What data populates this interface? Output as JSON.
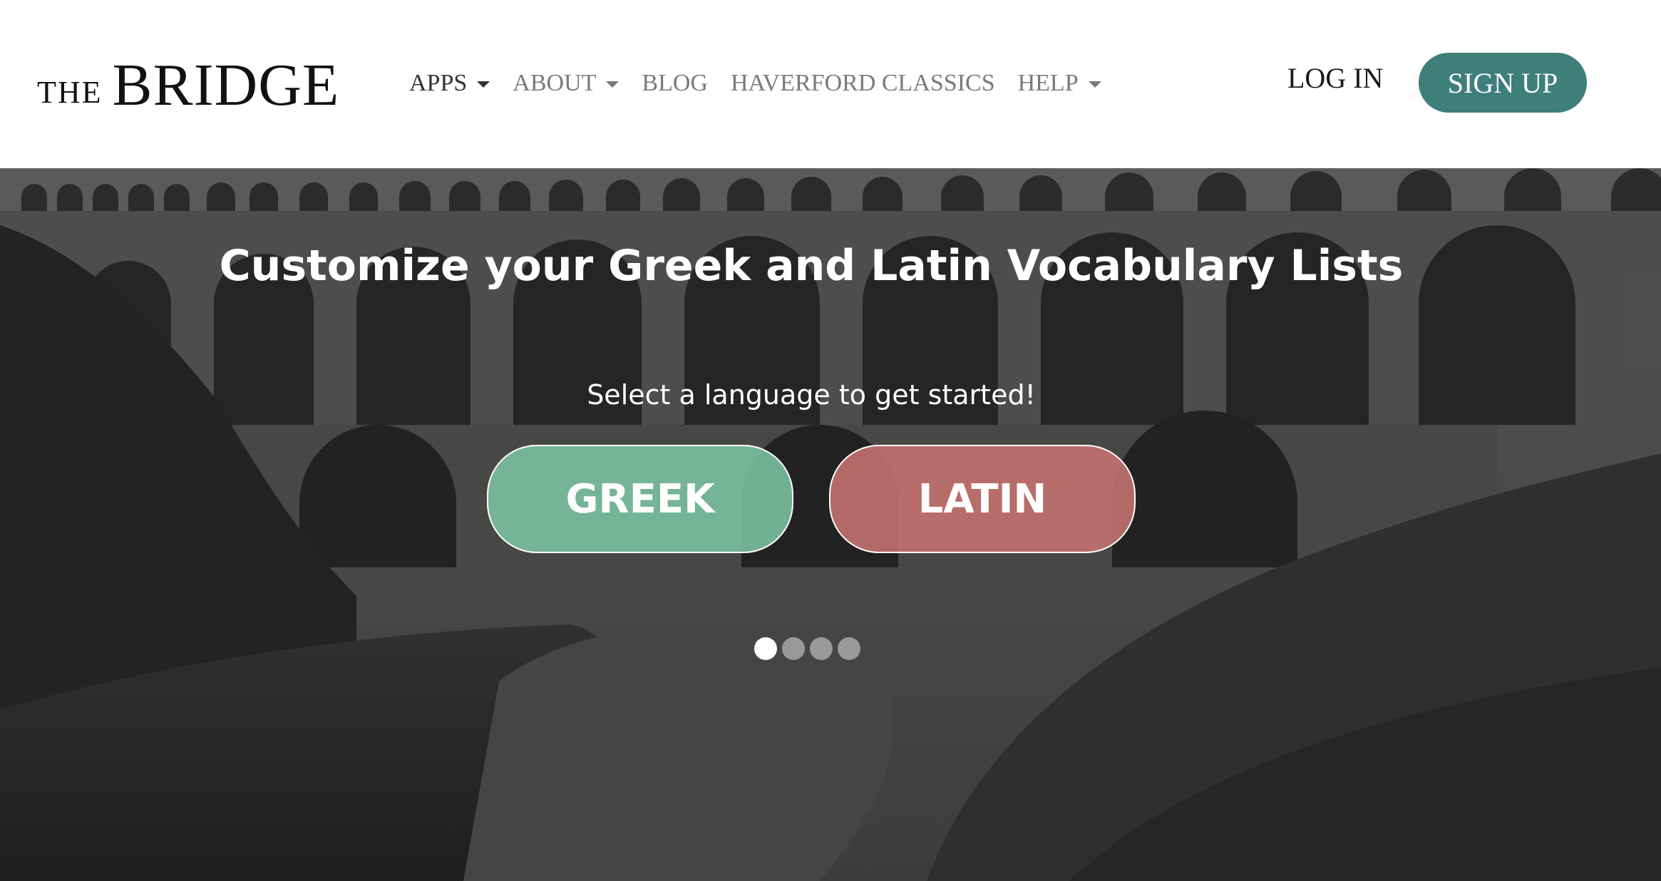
{
  "header": {
    "logo_small": "THE",
    "logo_big": "BRIDGE",
    "nav": [
      {
        "label": "APPS",
        "dropdown": true
      },
      {
        "label": "ABOUT",
        "dropdown": true
      },
      {
        "label": "BLOG",
        "dropdown": false
      },
      {
        "label": "HAVERFORD CLASSICS",
        "dropdown": false
      },
      {
        "label": "HELP",
        "dropdown": true
      }
    ],
    "login_label": "LOG IN",
    "signup_label": "SIGN UP"
  },
  "hero": {
    "title": "Customize your Greek and Latin Vocabulary Lists",
    "subtitle": "Select a language to get started!",
    "buttons": {
      "greek": "GREEK",
      "latin": "LATIN"
    },
    "carousel": {
      "count": 4,
      "active_index": 0
    }
  },
  "colors": {
    "signup_bg": "#3e7f7c",
    "greek_bg": "#7dc4a3",
    "latin_bg": "#c77470",
    "header_bg": "#ffffff"
  },
  "icons": {
    "nav_dropdown": "caret-down-icon"
  }
}
